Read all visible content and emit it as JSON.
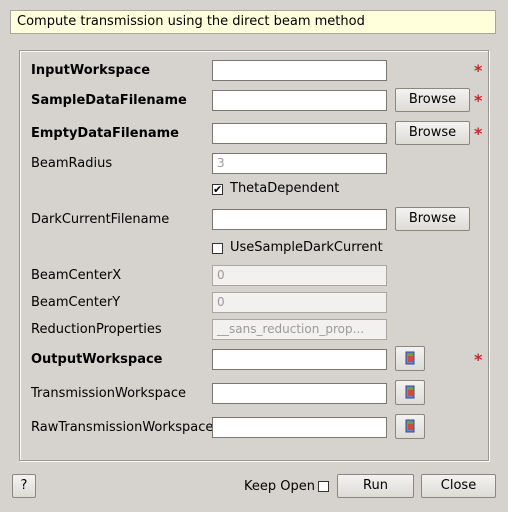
{
  "description": "Compute transmission using the direct beam method",
  "fields": {
    "input_workspace": {
      "label": "InputWorkspace",
      "value": ""
    },
    "sample_data_filename": {
      "label": "SampleDataFilename",
      "value": ""
    },
    "empty_data_filename": {
      "label": "EmptyDataFilename",
      "value": ""
    },
    "beam_radius": {
      "label": "BeamRadius",
      "value": "3"
    },
    "theta_dependent": {
      "label": "ThetaDependent",
      "checked": true
    },
    "dark_current_filename": {
      "label": "DarkCurrentFilename",
      "value": ""
    },
    "use_sample_dark_current": {
      "label": "UseSampleDarkCurrent",
      "checked": false
    },
    "beam_center_x": {
      "label": "BeamCenterX",
      "value": "0"
    },
    "beam_center_y": {
      "label": "BeamCenterY",
      "value": "0"
    },
    "reduction_properties": {
      "label": "ReductionProperties",
      "value": "__sans_reduction_prop..."
    },
    "output_workspace": {
      "label": "OutputWorkspace",
      "value": ""
    },
    "transmission_workspace": {
      "label": "TransmissionWorkspace",
      "value": ""
    },
    "raw_transmission_workspace": {
      "label": "RawTransmissionWorkspace",
      "value": ""
    }
  },
  "buttons": {
    "browse": "Browse",
    "help": "?",
    "keep_open": "Keep Open",
    "run": "Run",
    "close": "Close"
  },
  "required_marker": "*",
  "colors": {
    "required": "#c62828",
    "description_bg": "#ffffdc",
    "window_bg": "#d6d3ce"
  }
}
